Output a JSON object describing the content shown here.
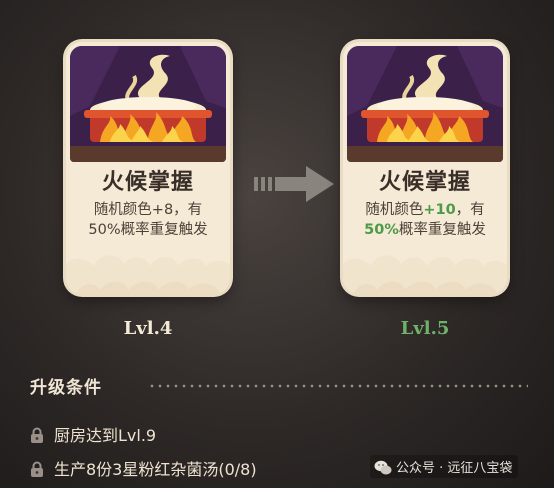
{
  "current_card": {
    "title": "火候掌握",
    "desc_line1": "随机颜色+8，有",
    "desc_line2": "50%概率重复触发",
    "level": "Lvl.4"
  },
  "next_card": {
    "title": "火候掌握",
    "desc_prefix": "随机颜色",
    "desc_value": "+10",
    "desc_suffix": "，有",
    "desc_percent": "50%",
    "desc_line2_rest": "概率重复触发",
    "level": "Lvl.5"
  },
  "requirements": {
    "title": "升级条件",
    "items": [
      {
        "text": "厨房达到Lvl.9",
        "icon": "lock-icon"
      },
      {
        "text": "生产8份3星粉红杂菌汤(0/8)",
        "icon": "lock-icon"
      }
    ]
  },
  "watermark": {
    "text": "公众号 · 远征八宝袋"
  },
  "colors": {
    "highlight_green": "#4e9a48",
    "next_level_green": "#6fb36a",
    "card_bg": "#f4ead6",
    "art_purple": "#3b2049"
  }
}
